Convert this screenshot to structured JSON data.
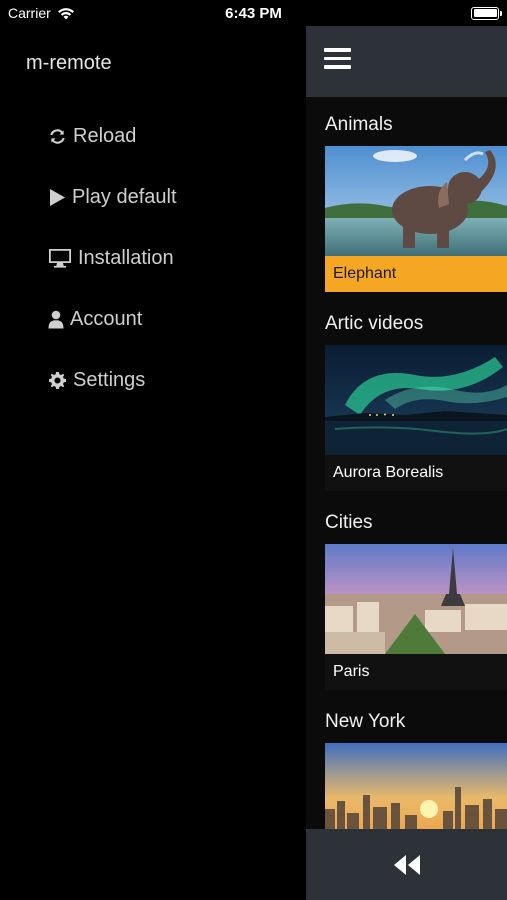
{
  "status": {
    "carrier": "Carrier",
    "time": "6:43 PM"
  },
  "menu": {
    "title": "m-remote",
    "items": [
      {
        "label": "Reload",
        "icon": "refresh-icon"
      },
      {
        "label": "Play default",
        "icon": "play-icon"
      },
      {
        "label": "Installation",
        "icon": "monitor-icon"
      },
      {
        "label": "Account",
        "icon": "user-icon"
      },
      {
        "label": "Settings",
        "icon": "gear-icon"
      }
    ]
  },
  "panel": {
    "sections": [
      {
        "title": "Animals",
        "video": "Elephant",
        "selected": true
      },
      {
        "title": "Artic videos",
        "video": "Aurora Borealis",
        "selected": false
      },
      {
        "title": "Cities",
        "video": "Paris",
        "selected": false
      },
      {
        "title": "New York",
        "video": "",
        "selected": false
      }
    ]
  },
  "colors": {
    "accent": "#f5a623",
    "bar": "#2d3238"
  }
}
